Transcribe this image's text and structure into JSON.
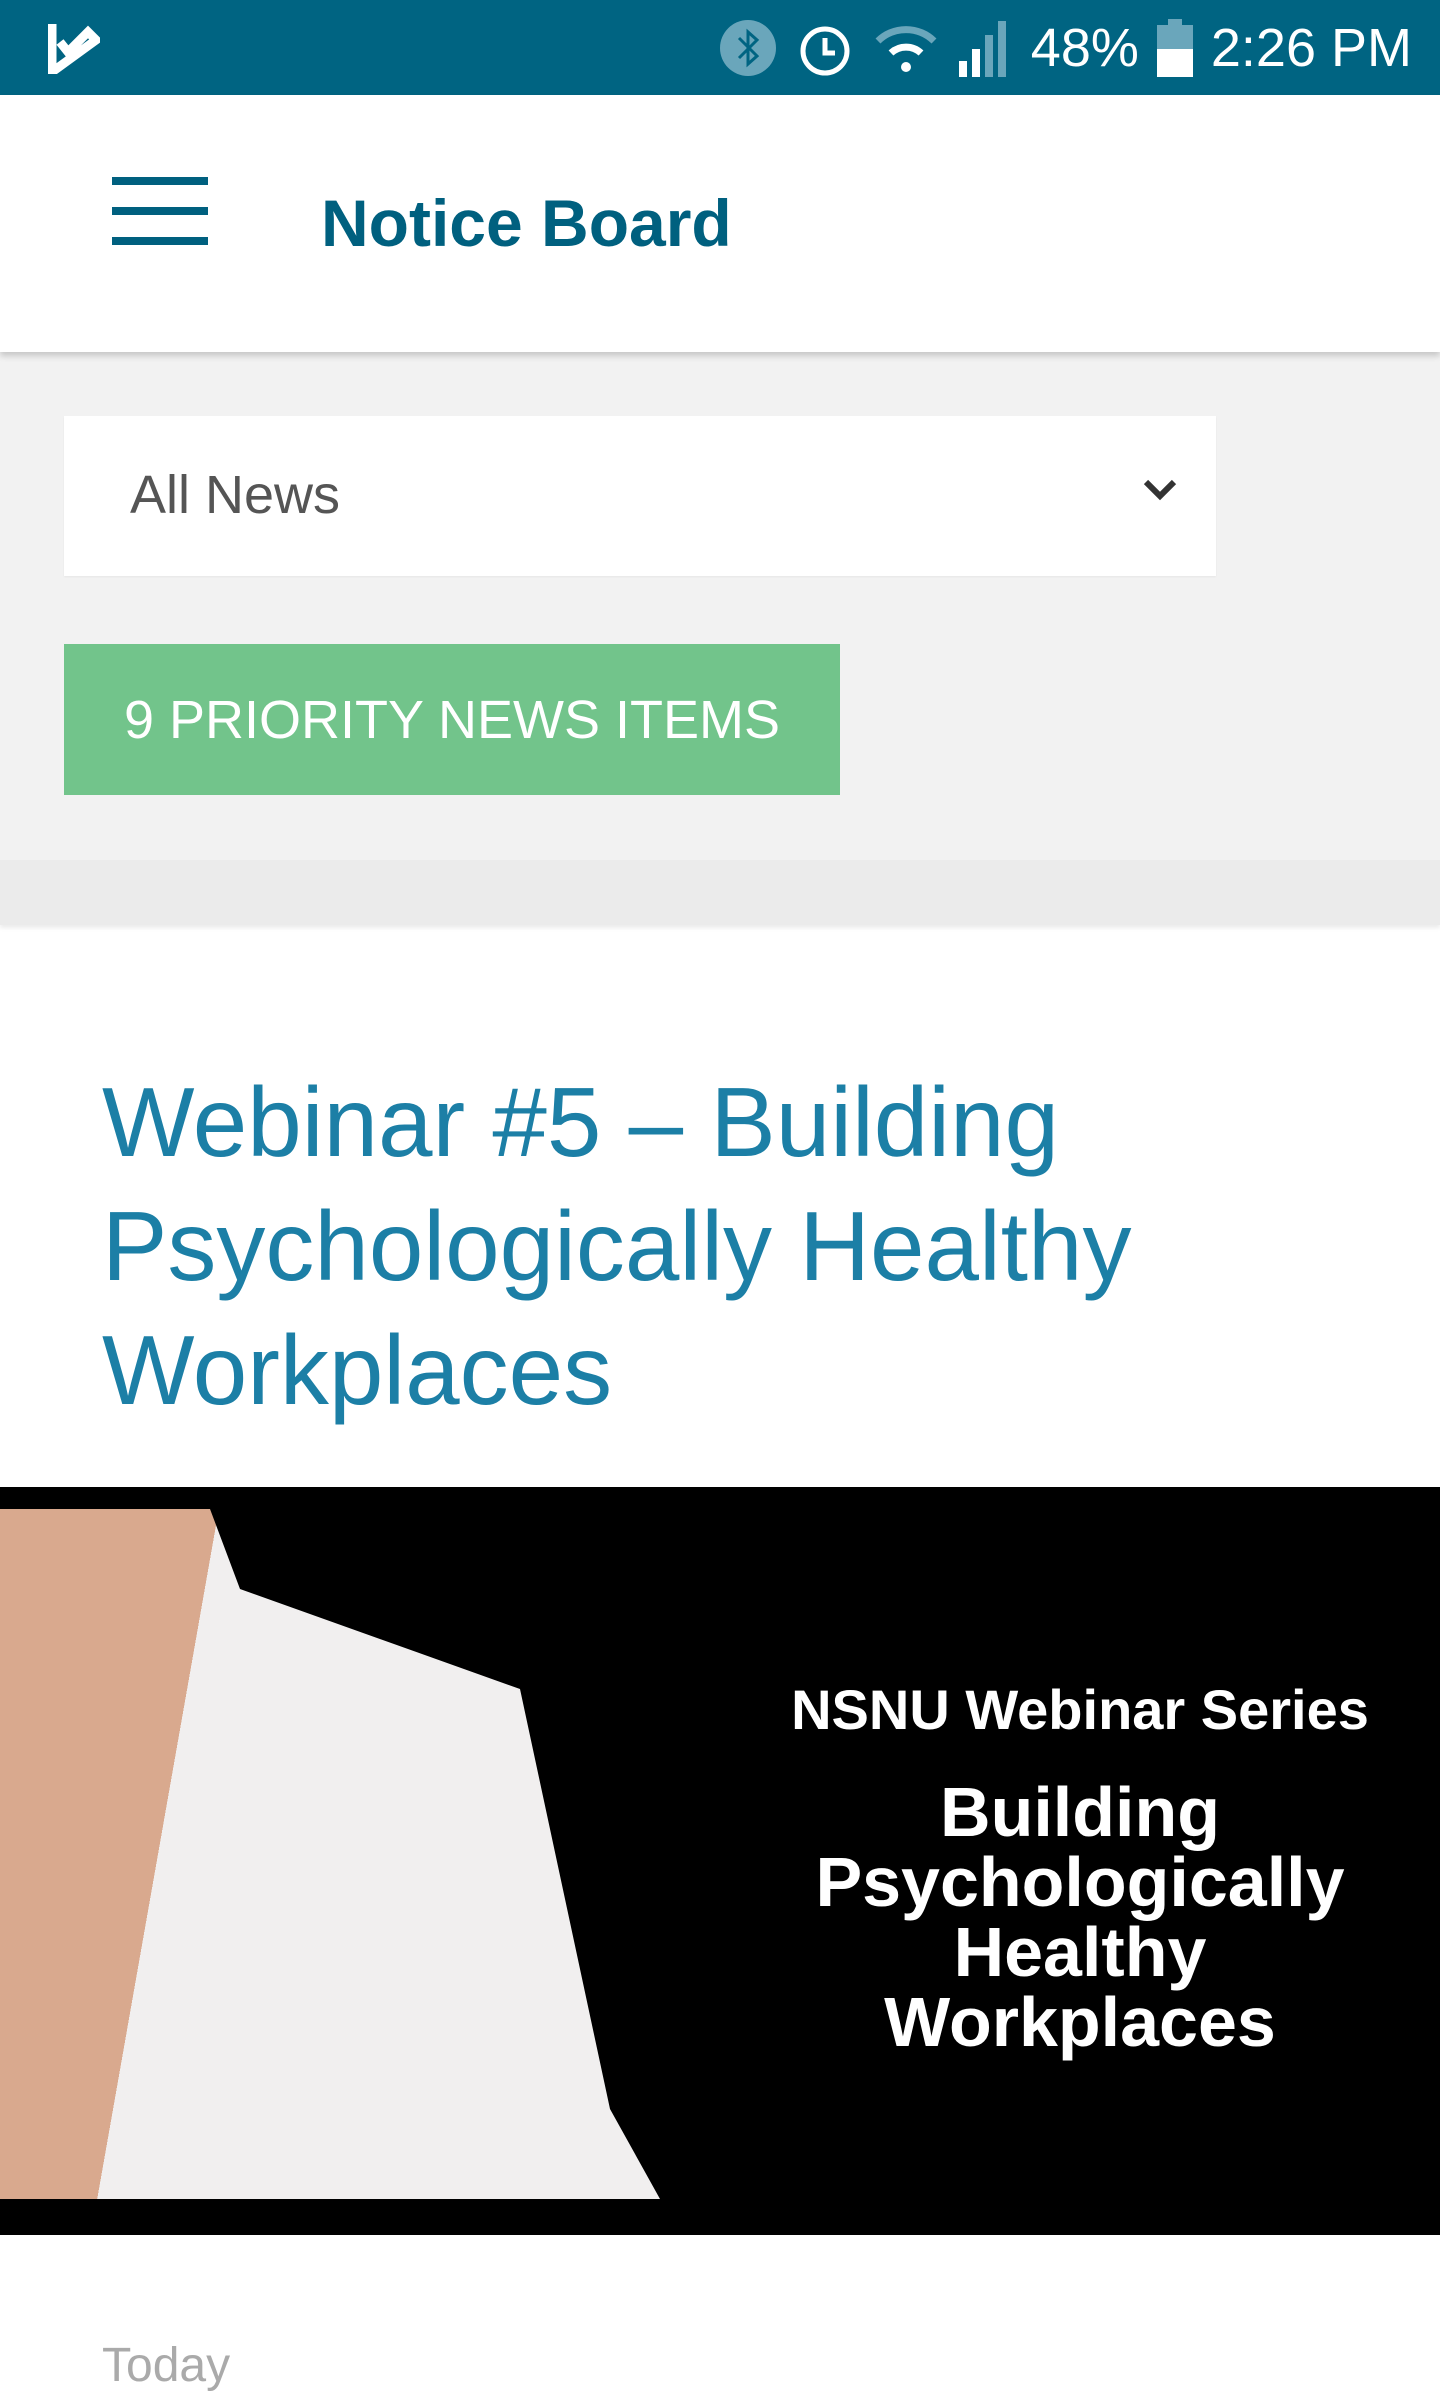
{
  "status_bar": {
    "battery": "48%",
    "time": "2:26 PM",
    "icons": [
      "app-check-icon",
      "bluetooth-icon",
      "alarm-icon",
      "wifi-icon",
      "signal-icon",
      "battery-icon"
    ]
  },
  "app_bar": {
    "title": "Notice Board",
    "menu_icon": "hamburger-icon"
  },
  "filter": {
    "selected": "All News"
  },
  "priority_button": {
    "label": "9 PRIORITY NEWS ITEMS"
  },
  "article": {
    "title": "Webinar #5 – Building Psychologically Healthy Workplaces",
    "image": {
      "series": "NSNU Webinar Series",
      "heading_lines": [
        "Building",
        "Psychologically",
        "Healthy",
        "Workplaces"
      ]
    },
    "date": "Today"
  },
  "colors": {
    "status_bar": "#006482",
    "accent": "#00607f",
    "priority_green": "#72c48b",
    "title_blue": "#1c7fa6"
  }
}
